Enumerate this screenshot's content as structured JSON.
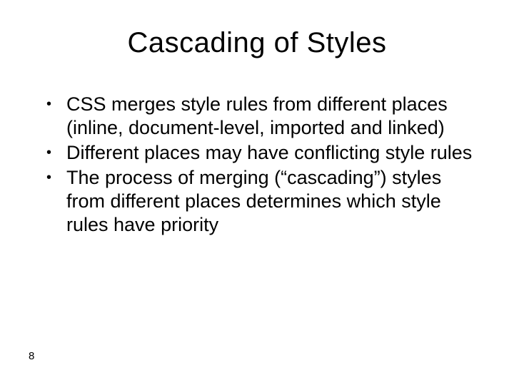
{
  "title": "Cascading of Styles",
  "bullets": [
    "CSS merges style rules from different places (inline, document-level, imported and linked)",
    "Different places may have conflicting style rules",
    "The process of merging (“cascading”) styles from different places determines which style rules have priority"
  ],
  "page_number": "8"
}
